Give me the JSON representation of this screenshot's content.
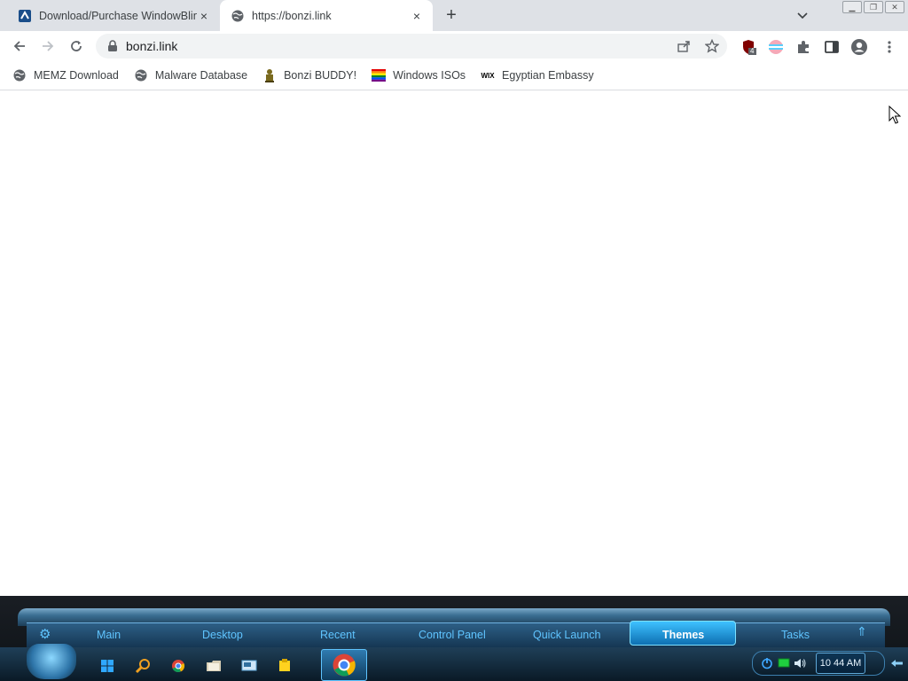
{
  "tabs": [
    {
      "title": "Download/Purchase WindowBlinds",
      "close": "×"
    },
    {
      "title": "https://bonzi.link",
      "close": "×"
    }
  ],
  "new_tab_label": "+",
  "address_bar": {
    "url": "bonzi.link"
  },
  "extension_badge": "4",
  "bookmarks": [
    {
      "label": "MEMZ Download",
      "icon": "globe-icon"
    },
    {
      "label": "Malware Database",
      "icon": "globe-icon"
    },
    {
      "label": "Bonzi BUDDY!",
      "icon": "bonzi-icon"
    },
    {
      "label": "Windows ISOs",
      "icon": "rainbow-flag-icon"
    },
    {
      "label": "Egyptian Embassy",
      "icon": "wix-icon"
    }
  ],
  "taskbar": {
    "menu": [
      "Main",
      "Desktop",
      "Recent",
      "Control Panel",
      "Quick Launch",
      "Themes",
      "Tasks"
    ],
    "active_menu": "Themes",
    "clock": "10 44 AM"
  },
  "colors": {
    "tabstrip": "#dee1e6",
    "taskbar_accent": "#5fc4ff",
    "themes_highlight": "#3ec1ff"
  }
}
